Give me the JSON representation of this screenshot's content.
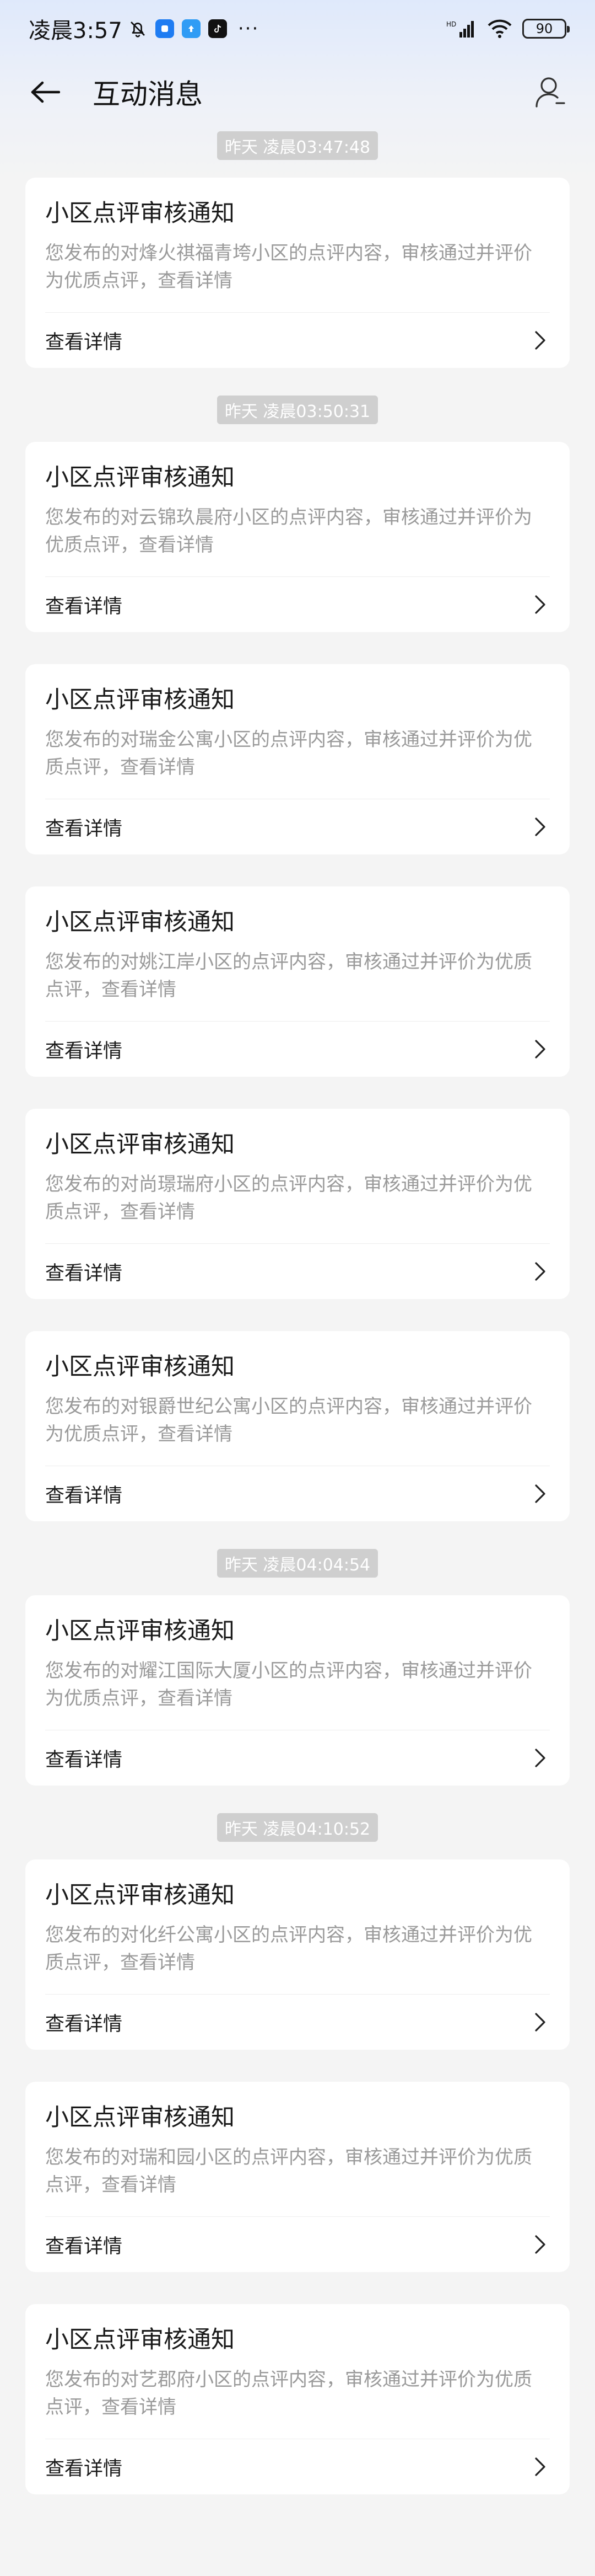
{
  "status_bar": {
    "time": "凌晨3:57",
    "battery": "90"
  },
  "nav": {
    "title": "互动消息"
  },
  "notification_common": {
    "title": "小区点评审核通知",
    "detail_label": "查看详情"
  },
  "timestamps": [
    "昨天 凌晨03:47:48",
    "昨天 凌晨03:50:31",
    "昨天 凌晨04:04:54",
    "昨天 凌晨04:10:52"
  ],
  "notifications": [
    {
      "title": "小区点评审核通知",
      "desc": "您发布的对烽火祺福青垮小区的点评内容，审核通过并评价为优质点评，查看详情",
      "detail": "查看详情"
    },
    {
      "title": "小区点评审核通知",
      "desc": "您发布的对云锦玖晨府小区的点评内容，审核通过并评价为优质点评，查看详情",
      "detail": "查看详情"
    },
    {
      "title": "小区点评审核通知",
      "desc": "您发布的对瑞金公寓小区的点评内容，审核通过并评价为优质点评，查看详情",
      "detail": "查看详情"
    },
    {
      "title": "小区点评审核通知",
      "desc": "您发布的对姚江岸小区的点评内容，审核通过并评价为优质点评，查看详情",
      "detail": "查看详情"
    },
    {
      "title": "小区点评审核通知",
      "desc": "您发布的对尚璟瑞府小区的点评内容，审核通过并评价为优质点评，查看详情",
      "detail": "查看详情"
    },
    {
      "title": "小区点评审核通知",
      "desc": "您发布的对银爵世纪公寓小区的点评内容，审核通过并评价为优质点评，查看详情",
      "detail": "查看详情"
    },
    {
      "title": "小区点评审核通知",
      "desc": "您发布的对耀江国际大厦小区的点评内容，审核通过并评价为优质点评，查看详情",
      "detail": "查看详情"
    },
    {
      "title": "小区点评审核通知",
      "desc": "您发布的对化纤公寓小区的点评内容，审核通过并评价为优质点评，查看详情",
      "detail": "查看详情"
    },
    {
      "title": "小区点评审核通知",
      "desc": "您发布的对瑞和园小区的点评内容，审核通过并评价为优质点评，查看详情",
      "detail": "查看详情"
    },
    {
      "title": "小区点评审核通知",
      "desc": "您发布的对艺郡府小区的点评内容，审核通过并评价为优质点评，查看详情",
      "detail": "查看详情"
    }
  ],
  "icons": {
    "back": "arrow-left-icon",
    "profile": "user-icon",
    "chevron": "chevron-right-icon",
    "mute": "bell-off-icon",
    "signal": "signal-icon",
    "wifi": "wifi-icon"
  },
  "colors": {
    "chip_bg": "#cfcfcf",
    "card_bg": "#ffffff",
    "page_bg": "#f4f4f4",
    "desc_text": "#9a9a9a"
  }
}
